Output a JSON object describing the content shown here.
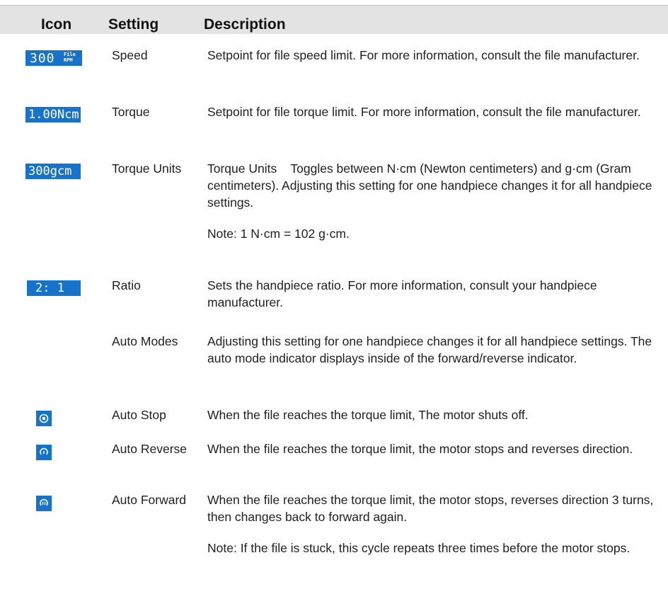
{
  "header": {
    "icon": "Icon",
    "setting": "Setting",
    "description": "Description"
  },
  "colors": {
    "accent": "#1673c9",
    "header_bg": "#e3e3e3"
  },
  "rows": [
    {
      "icon": "speed-display-icon",
      "icon_text": {
        "value": "300",
        "sub_top": "File",
        "sub_bottom": "RPM"
      },
      "setting": "Speed",
      "description": "Setpoint for file speed limit. For more information, consult the file manufacturer."
    },
    {
      "icon": "torque-display-icon",
      "icon_text": {
        "value": "1.00Ncm"
      },
      "setting": "Torque",
      "description": "Setpoint for file torque limit. For more information, consult the file manufacturer."
    },
    {
      "icon": "torque-units-display-icon",
      "icon_text": {
        "value": "300gcm"
      },
      "setting": "Torque Units",
      "description": "Torque Units    Toggles between N·cm (Newton centimeters) and g·cm (Gram centimeters). Adjusting this setting for one handpiece changes it for all handpiece settings.",
      "note": "Note: 1 N·cm = 102 g·cm."
    },
    {
      "icon": "ratio-display-icon",
      "icon_text": {
        "value": "2: 1"
      },
      "setting": "Ratio",
      "description": "Sets the handpiece ratio. For more information, consult your handpiece manufacturer."
    },
    {
      "icon": "",
      "setting": "Auto Modes",
      "description": "Adjusting this setting for one handpiece changes it for all handpiece settings. The auto mode indicator displays inside of the forward/reverse indicator."
    },
    {
      "icon": "auto-stop-icon",
      "setting": "Auto Stop",
      "description": "When the file reaches the torque limit, The motor shuts off."
    },
    {
      "icon": "auto-reverse-icon",
      "setting": "Auto Reverse",
      "description": "When the file reaches the torque limit, the motor stops and reverses direction."
    },
    {
      "icon": "auto-forward-icon",
      "setting": "Auto Forward",
      "description": "When the file reaches the torque limit, the motor stops, reverses direction 3 turns, then changes back to forward again.",
      "note": "Note: If the file is stuck, this cycle repeats three times before the motor stops."
    }
  ]
}
